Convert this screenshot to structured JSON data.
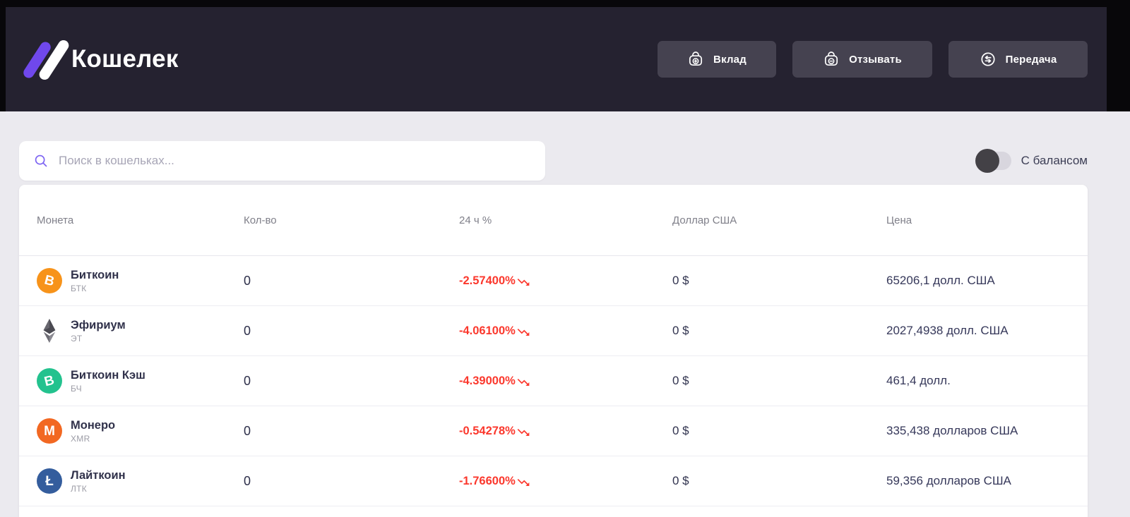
{
  "header": {
    "app_title": "Кошелек",
    "buttons": [
      {
        "label": "Вклад",
        "icon": "wallet-plus-icon"
      },
      {
        "label": "Отзывать",
        "icon": "wallet-minus-icon"
      },
      {
        "label": "Передача",
        "icon": "transfer-arrows-icon"
      }
    ]
  },
  "search": {
    "placeholder": "Поиск в кошельках...",
    "value": "",
    "icon": "search-icon"
  },
  "balance_toggle": {
    "label": "С балансом",
    "state": "off"
  },
  "table": {
    "columns": [
      "Монета",
      "Кол-во",
      "24 ч %",
      "Доллар США",
      "Цена"
    ],
    "rows": [
      {
        "name": "Биткоин",
        "symbol": "БТК",
        "qty": "0",
        "change": "-2.57400%",
        "trend": "down",
        "usd": "0 $",
        "price": "65206,1 долл. США",
        "icon": {
          "name": "bitcoin-icon",
          "kind": "glyph",
          "bg": "#f7931a",
          "glyph": "B",
          "tilt": "14deg"
        }
      },
      {
        "name": "Эфириум",
        "symbol": "ЭТ",
        "qty": "0",
        "change": "-4.06100%",
        "trend": "down",
        "usd": "0 $",
        "price": "2027,4938 долл. США",
        "icon": {
          "name": "ethereum-icon",
          "kind": "eth"
        }
      },
      {
        "name": "Биткоин Кэш",
        "symbol": "БЧ",
        "qty": "0",
        "change": "-4.39000%",
        "trend": "down",
        "usd": "0 $",
        "price": "461,4 долл.",
        "icon": {
          "name": "bitcoin-cash-icon",
          "kind": "glyph",
          "bg": "#23c28e",
          "glyph": "B",
          "tilt": "-14deg"
        }
      },
      {
        "name": "Монеро",
        "symbol": "XMR",
        "qty": "0",
        "change": "-0.54278%",
        "trend": "down",
        "usd": "0 $",
        "price": "335,438 долларов США",
        "icon": {
          "name": "monero-icon",
          "kind": "glyph",
          "bg": "#f26822",
          "glyph": "M",
          "tilt": "0deg"
        }
      },
      {
        "name": "Лайткоин",
        "symbol": "ЛТК",
        "qty": "0",
        "change": "-1.76600%",
        "trend": "down",
        "usd": "0 $",
        "price": "59,356 долларов США",
        "icon": {
          "name": "litecoin-icon",
          "kind": "glyph",
          "bg": "#345d9d",
          "glyph": "Ł",
          "tilt": "0deg"
        }
      }
    ]
  },
  "colors": {
    "accent": "#7048ec",
    "negative": "#fb382d",
    "header_bg": "#252230",
    "button_bg": "#454250"
  }
}
